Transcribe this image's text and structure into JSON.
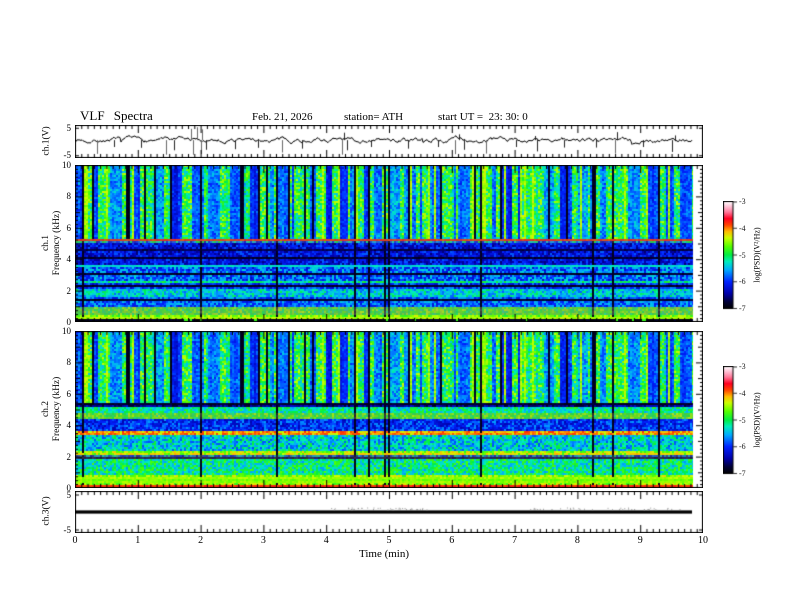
{
  "header": {
    "title": "VLF Spectra",
    "date": "Feb. 21, 2026",
    "station": "station= ATH",
    "start_ut": "start UT =  23: 30: 0"
  },
  "xaxis": {
    "label": "Time (min)",
    "ticks": [
      "0",
      "1",
      "2",
      "3",
      "4",
      "5",
      "6",
      "7",
      "8",
      "9",
      "10"
    ],
    "minutes_total": 10,
    "data_end_min": 9.82
  },
  "panels": {
    "waveform": {
      "ylabel": "ch.1(V)",
      "yticks": [
        "5",
        "-5"
      ]
    },
    "spec1": {
      "ylabel_line1": "ch.1",
      "ylabel_line2": "Frequency (kHz)",
      "yticks": [
        "10",
        "8",
        "6",
        "4",
        "2",
        "0"
      ]
    },
    "spec2": {
      "ylabel_line1": "ch.2",
      "ylabel_line2": "Frequency (kHz)",
      "yticks": [
        "10",
        "8",
        "6",
        "4",
        "2",
        "0"
      ]
    },
    "ch3": {
      "ylabel": "ch.3(V)",
      "yticks": [
        "5",
        "-5"
      ]
    }
  },
  "colorbar": {
    "label": "log(PSD)(V²/Hz)",
    "ticks": [
      "-3",
      "-4",
      "-5",
      "-6",
      "-7"
    ],
    "colormap": [
      [
        0.0,
        "#000002"
      ],
      [
        0.06,
        "#000033"
      ],
      [
        0.14,
        "#0000aa"
      ],
      [
        0.25,
        "#0022ff"
      ],
      [
        0.36,
        "#00aaff"
      ],
      [
        0.44,
        "#00eebb"
      ],
      [
        0.5,
        "#00ee44"
      ],
      [
        0.58,
        "#55ff00"
      ],
      [
        0.66,
        "#ccff00"
      ],
      [
        0.72,
        "#ffbb00"
      ],
      [
        0.78,
        "#ff4400"
      ],
      [
        0.84,
        "#ff0022"
      ],
      [
        0.9,
        "#ff7799"
      ],
      [
        0.96,
        "#ffccdd"
      ],
      [
        1.0,
        "#ffffff"
      ]
    ]
  },
  "chart_data": [
    {
      "type": "line",
      "name": "ch.1 voltage time series",
      "xlabel": "Time (min)",
      "xlim": [
        0,
        10
      ],
      "ylabel": "ch.1(V)",
      "ylim": [
        -6,
        6
      ],
      "yticks": [
        5,
        -5
      ],
      "baseline": 0.5,
      "noise_amp": 1.1,
      "seed": 7,
      "spikes_down": [
        [
          0.35,
          -4.5
        ],
        [
          0.62,
          -2.0
        ],
        [
          1.05,
          -2.3
        ],
        [
          1.45,
          -4.8
        ],
        [
          1.57,
          -3.2
        ],
        [
          1.88,
          -4.8
        ],
        [
          2.0,
          -4.6
        ],
        [
          2.08,
          -3.0
        ],
        [
          2.55,
          -2.8
        ],
        [
          2.92,
          -2.3
        ],
        [
          3.3,
          -4.0
        ],
        [
          3.62,
          -2.6
        ],
        [
          4.25,
          -4.8
        ],
        [
          4.33,
          -3.2
        ],
        [
          4.72,
          -2.0
        ],
        [
          5.3,
          -2.6
        ],
        [
          5.78,
          -2.0
        ],
        [
          6.05,
          -4.6
        ],
        [
          6.2,
          -3.0
        ],
        [
          6.55,
          -4.4
        ],
        [
          7.02,
          -2.0
        ],
        [
          7.35,
          -3.6
        ],
        [
          7.78,
          -2.2
        ],
        [
          8.3,
          -2.2
        ],
        [
          8.6,
          -4.4
        ],
        [
          9.05,
          -2.0
        ],
        [
          9.5,
          -3.8
        ]
      ],
      "spikes_up": [
        [
          1.85,
          4.6
        ],
        [
          1.95,
          5.2
        ],
        [
          2.03,
          4.4
        ],
        [
          4.28,
          3.2
        ],
        [
          6.12,
          2.6
        ],
        [
          7.32,
          2.0
        ],
        [
          8.63,
          3.4
        ],
        [
          9.55,
          2.2
        ]
      ]
    },
    {
      "type": "heatmap",
      "name": "ch.1 VLF spectrogram",
      "ylabel": "ch.1 Frequency (kHz)",
      "ylim": [
        0,
        10
      ],
      "clim": [
        -7,
        -3
      ],
      "seed": 11,
      "bands": [
        {
          "f": [
            0,
            0.22
          ],
          "level": 0.03,
          "noise": 0.03,
          "vgreen": 0.06
        },
        {
          "f": [
            0.22,
            0.4
          ],
          "level": 0.6,
          "noise": 0.08
        },
        {
          "f": [
            0.4,
            0.95
          ],
          "level": 0.55,
          "noise": 0.1,
          "tint": "#8a8a70",
          "tintAmt": 0.55
        },
        {
          "f": [
            0.95,
            1.55
          ],
          "level": 0.3,
          "noise": 0.1
        },
        {
          "f": [
            1.55,
            2.15
          ],
          "level": 0.4,
          "noise": 0.1
        },
        {
          "f": [
            2.15,
            2.45
          ],
          "level": 0.26,
          "noise": 0.1
        },
        {
          "f": [
            2.45,
            2.65
          ],
          "level": 0.46,
          "noise": 0.08
        },
        {
          "f": [
            2.65,
            3.55
          ],
          "level": 0.3,
          "noise": 0.12
        },
        {
          "f": [
            3.55,
            5.05
          ],
          "level": 0.2,
          "noise": 0.1
        },
        {
          "f": [
            5.05,
            5.3
          ],
          "level": 0.34,
          "noise": 0.18,
          "tint": "#7a7a60",
          "tintAmt": 0.35
        },
        {
          "f": [
            5.3,
            10.01
          ],
          "level": 0.52,
          "noise": 0.14,
          "streak": true
        }
      ],
      "hlines": [
        {
          "f": 5.18,
          "level": 0.8
        },
        {
          "f": 4.05,
          "level": 0.05
        },
        {
          "f": 3.6,
          "level": 0.42
        },
        {
          "f": 3.05,
          "level": 0.05
        },
        {
          "f": 2.32,
          "level": 0.04
        },
        {
          "f": 1.38,
          "level": 0.05
        },
        {
          "f": 0.3,
          "level": 0.64
        },
        {
          "f": 4.55,
          "level": 0.08
        }
      ],
      "streaks": {
        "fmin": 5.3,
        "density": 0.3,
        "black_lines": 34,
        "green_lines": 26,
        "dark_level": 0.17,
        "seed": 99
      }
    },
    {
      "type": "heatmap",
      "name": "ch.2 VLF spectrogram",
      "ylabel": "ch.2 Frequency (kHz)",
      "ylim": [
        0,
        10
      ],
      "clim": [
        -7,
        -3
      ],
      "seed": 23,
      "bands": [
        {
          "f": [
            0,
            0.2
          ],
          "level": 0.03,
          "noise": 0.03,
          "vgreen": 0.06
        },
        {
          "f": [
            0.2,
            0.8
          ],
          "level": 0.5,
          "noise": 0.08,
          "stripes": true
        },
        {
          "f": [
            0.8,
            1.9
          ],
          "level": 0.46,
          "noise": 0.12
        },
        {
          "f": [
            1.9,
            2.1
          ],
          "level": 0.3,
          "noise": 0.15,
          "tint": "#6a6a40",
          "tintAmt": 0.5
        },
        {
          "f": [
            2.1,
            2.4
          ],
          "level": 0.63,
          "noise": 0.09
        },
        {
          "f": [
            2.4,
            3.35
          ],
          "level": 0.4,
          "noise": 0.12
        },
        {
          "f": [
            3.35,
            3.6
          ],
          "level": 0.72,
          "noise": 0.08
        },
        {
          "f": [
            3.6,
            4.45
          ],
          "level": 0.25,
          "noise": 0.1
        },
        {
          "f": [
            4.45,
            4.75
          ],
          "level": 0.55,
          "noise": 0.1,
          "tint": "#8a8a60",
          "tintAmt": 0.4
        },
        {
          "f": [
            4.75,
            5.2
          ],
          "level": 0.45,
          "noise": 0.1
        },
        {
          "f": [
            5.2,
            5.45
          ],
          "level": 0.12,
          "noise": 0.08
        },
        {
          "f": [
            5.45,
            10.01
          ],
          "level": 0.52,
          "noise": 0.14,
          "streak": true
        }
      ],
      "hlines": [
        {
          "f": 0.15,
          "level": 0.8
        },
        {
          "f": 0.35,
          "level": 0.62
        },
        {
          "f": 0.5,
          "level": 0.6
        },
        {
          "f": 0.65,
          "level": 0.63
        },
        {
          "f": 1.95,
          "level": 0.08
        },
        {
          "f": 5.3,
          "level": 0.05
        },
        {
          "f": 2.2,
          "level": 0.7,
          "dash": true
        },
        {
          "f": 3.48,
          "level": 0.76,
          "dash": true
        }
      ],
      "streaks": {
        "fmin": 5.45,
        "density": 0.3,
        "black_lines": 34,
        "green_lines": 26,
        "dark_level": 0.17,
        "seed": 99
      }
    },
    {
      "type": "line",
      "name": "ch.3 voltage time series",
      "ylabel": "ch.3(V)",
      "ylim": [
        -6,
        6
      ],
      "yticks": [
        5,
        -5
      ],
      "constant": 0,
      "line_width": 3.2,
      "speckle_ranges": [
        [
          4.0,
          5.6
        ],
        [
          7.2,
          9.7
        ]
      ]
    }
  ]
}
